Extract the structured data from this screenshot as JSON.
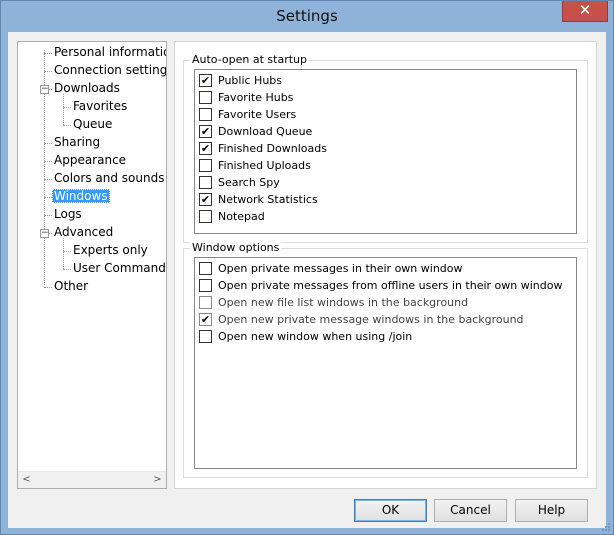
{
  "window": {
    "title": "Settings",
    "close_glyph": "✕"
  },
  "tree": {
    "items": [
      {
        "label": "Personal information",
        "depth": 0,
        "expander": "",
        "selected": false
      },
      {
        "label": "Connection settings",
        "depth": 0,
        "expander": "",
        "selected": false
      },
      {
        "label": "Downloads",
        "depth": 0,
        "expander": "−",
        "selected": false
      },
      {
        "label": "Favorites",
        "depth": 1,
        "expander": "",
        "selected": false
      },
      {
        "label": "Queue",
        "depth": 1,
        "expander": "",
        "selected": false
      },
      {
        "label": "Sharing",
        "depth": 0,
        "expander": "",
        "selected": false
      },
      {
        "label": "Appearance",
        "depth": 0,
        "expander": "",
        "selected": false
      },
      {
        "label": "Colors and sounds",
        "depth": 0,
        "expander": "",
        "selected": false
      },
      {
        "label": "Windows",
        "depth": 0,
        "expander": "",
        "selected": true
      },
      {
        "label": "Logs",
        "depth": 0,
        "expander": "",
        "selected": false
      },
      {
        "label": "Advanced",
        "depth": 0,
        "expander": "−",
        "selected": false
      },
      {
        "label": "Experts only",
        "depth": 1,
        "expander": "",
        "selected": false
      },
      {
        "label": "User Commands",
        "depth": 1,
        "expander": "",
        "selected": false
      },
      {
        "label": "Other",
        "depth": 0,
        "expander": "",
        "selected": false
      }
    ],
    "scroll_left": "<",
    "scroll_right": ">"
  },
  "auto_open": {
    "title": "Auto-open at startup",
    "items": [
      {
        "label": "Public Hubs",
        "checked": true
      },
      {
        "label": "Favorite Hubs",
        "checked": false
      },
      {
        "label": "Favorite Users",
        "checked": false
      },
      {
        "label": "Download Queue",
        "checked": true
      },
      {
        "label": "Finished Downloads",
        "checked": true
      },
      {
        "label": "Finished Uploads",
        "checked": false
      },
      {
        "label": "Search Spy",
        "checked": false
      },
      {
        "label": "Network Statistics",
        "checked": true
      },
      {
        "label": "Notepad",
        "checked": false
      }
    ]
  },
  "window_options": {
    "title": "Window options",
    "items": [
      {
        "label": "Open private messages in their own window",
        "checked": false,
        "dim": false
      },
      {
        "label": "Open private messages from offline users in their own window",
        "checked": false,
        "dim": false
      },
      {
        "label": "Open new file list windows in the background",
        "checked": false,
        "dim": true
      },
      {
        "label": "Open new private message windows in the background",
        "checked": true,
        "dim": true
      },
      {
        "label": "Open new window when using /join",
        "checked": false,
        "dim": false
      }
    ]
  },
  "buttons": {
    "ok": "OK",
    "cancel": "Cancel",
    "help": "Help"
  },
  "check_glyph": "✔"
}
